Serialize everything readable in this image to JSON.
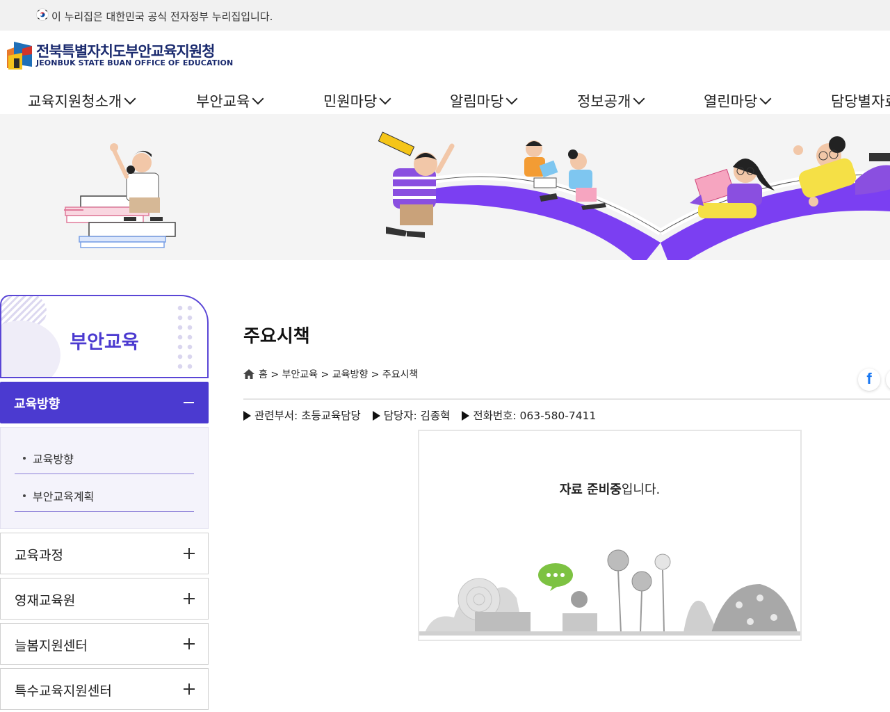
{
  "gov_banner": {
    "flag_icon": "korean-flag-icon",
    "text": "이 누리집은 대한민국 공식 전자정부 누리집입니다."
  },
  "logo": {
    "name_ko": "전북특별자치도부안교육지원청",
    "name_en": "JEONBUK STATE BUAN OFFICE OF EDUCATION"
  },
  "nav": {
    "items": [
      {
        "label": "교육지원청소개"
      },
      {
        "label": "부안교육"
      },
      {
        "label": "민원마당"
      },
      {
        "label": "알림마당"
      },
      {
        "label": "정보공개"
      },
      {
        "label": "열린마당"
      },
      {
        "label": "담당별자료"
      }
    ]
  },
  "sidebar": {
    "title": "부안교육",
    "active": {
      "label": "교육방향"
    },
    "sub_items": [
      {
        "label": "교육방향"
      },
      {
        "label": "부안교육계획"
      }
    ],
    "items": [
      {
        "label": "교육과정"
      },
      {
        "label": "영재교육원"
      },
      {
        "label": "늘봄지원센터"
      },
      {
        "label": "특수교육지원센터"
      }
    ]
  },
  "content": {
    "title": "주요시책",
    "breadcrumb": {
      "home": "홈",
      "sep": ">",
      "level1": "부안교육",
      "level2": "교육방향",
      "level3": "주요시책"
    },
    "info": {
      "dept": "관련부서: 초등교육담당",
      "manager": "담당자: 김종혁",
      "phone": "전화번호: 063-580-7411"
    },
    "notice": {
      "bold": "자료 준비중",
      "rest": "입니다."
    }
  },
  "social": {
    "facebook_glyph": "f"
  },
  "colors": {
    "accent": "#4b3ad0",
    "logo_navy": "#1a2a6e",
    "hero_purple": "#7b3ff2"
  }
}
